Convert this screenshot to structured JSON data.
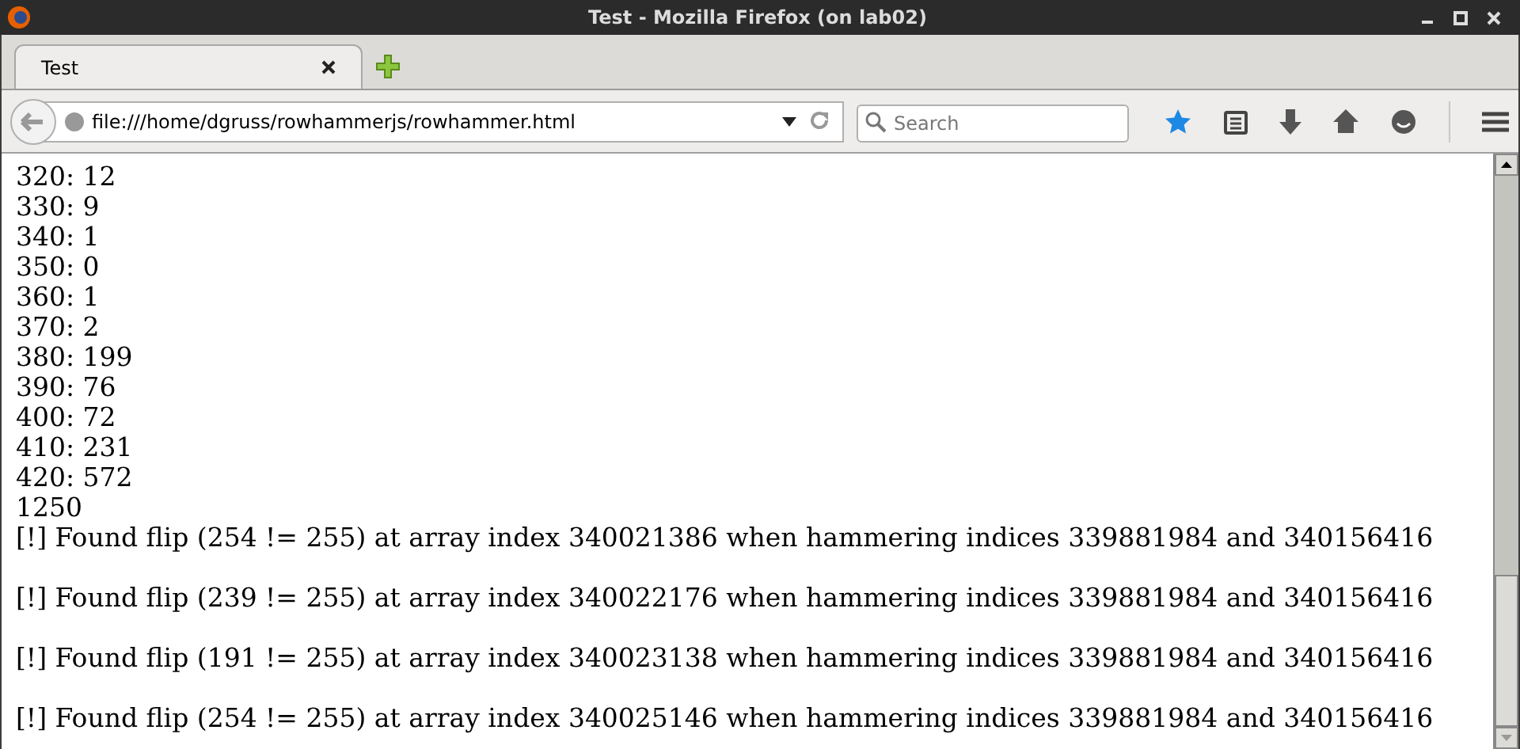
{
  "window": {
    "title": "Test - Mozilla Firefox (on lab02)"
  },
  "tabs": [
    {
      "label": "Test",
      "selected": true
    }
  ],
  "toolbar": {
    "url": "file:///home/dgruss/rowhammerjs/rowhammer.html",
    "search": {
      "placeholder": "Search"
    }
  },
  "content": {
    "lines": [
      "320: 12",
      "330: 9",
      "340: 1",
      "350: 0",
      "360: 1",
      "370: 2",
      "380: 199",
      "390: 76",
      "400: 72",
      "410: 231",
      "420: 572",
      "1250"
    ],
    "flips": [
      "[!] Found flip (254 != 255) at array index 340021386 when hammering indices 339881984 and 340156416",
      "[!] Found flip (239 != 255) at array index 340022176 when hammering indices 339881984 and 340156416",
      "[!] Found flip (191 != 255) at array index 340023138 when hammering indices 339881984 and 340156416",
      "[!] Found flip (254 != 255) at array index 340025146 when hammering indices 339881984 and 340156416"
    ]
  }
}
